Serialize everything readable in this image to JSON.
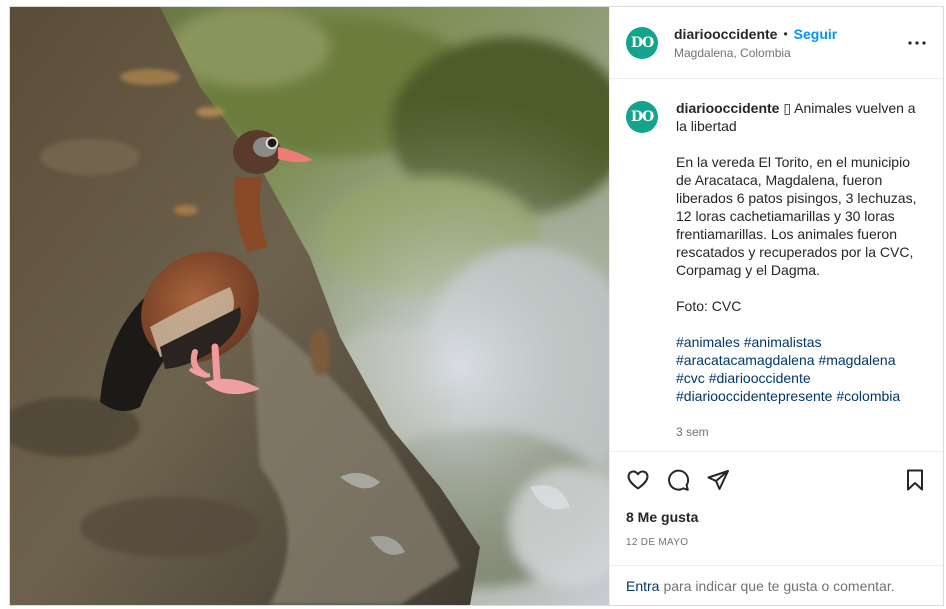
{
  "header": {
    "avatar_text": "DO",
    "username": "diariooccidente",
    "separator": "•",
    "follow_label": "Seguir",
    "location": "Magdalena, Colombia",
    "more_icon": "more-horizontal-icon"
  },
  "caption": {
    "avatar_text": "DO",
    "username": "diariooccidente",
    "headline": " ▯ Animales vuelven a la libertad",
    "paragraph": "En la vereda El Torito, en el municipio de Aracataca, Magdalena, fueron liberados 6 patos pisingos, 3 lechuzas, 12 loras cachetiamarillas y 30 loras frentiamarillas. Los animales fueron rescatados y recuperados por la CVC, Corpamag y el Dagma.",
    "credit": "Foto: CVC",
    "hashtags": [
      "#animales",
      "#animalistas",
      "#aracatacamagdalena",
      "#magdalena",
      "#cvc",
      "#diariooccidente",
      "#diariooccidentepresente",
      "#colombia"
    ],
    "time_ago": "3 sem"
  },
  "actions": {
    "like_icon": "heart-icon",
    "comment_icon": "comment-icon",
    "share_icon": "send-icon",
    "save_icon": "bookmark-icon"
  },
  "likes": "8 Me gusta",
  "date": "12 DE MAYO",
  "comment_bar": {
    "login_link": "Entra",
    "prompt": "para indicar que te gusta o comentar."
  },
  "colors": {
    "brand_avatar": "#14a38b",
    "link_blue": "#0095f6",
    "hashtag": "#00376b",
    "secondary_text": "#737373"
  }
}
